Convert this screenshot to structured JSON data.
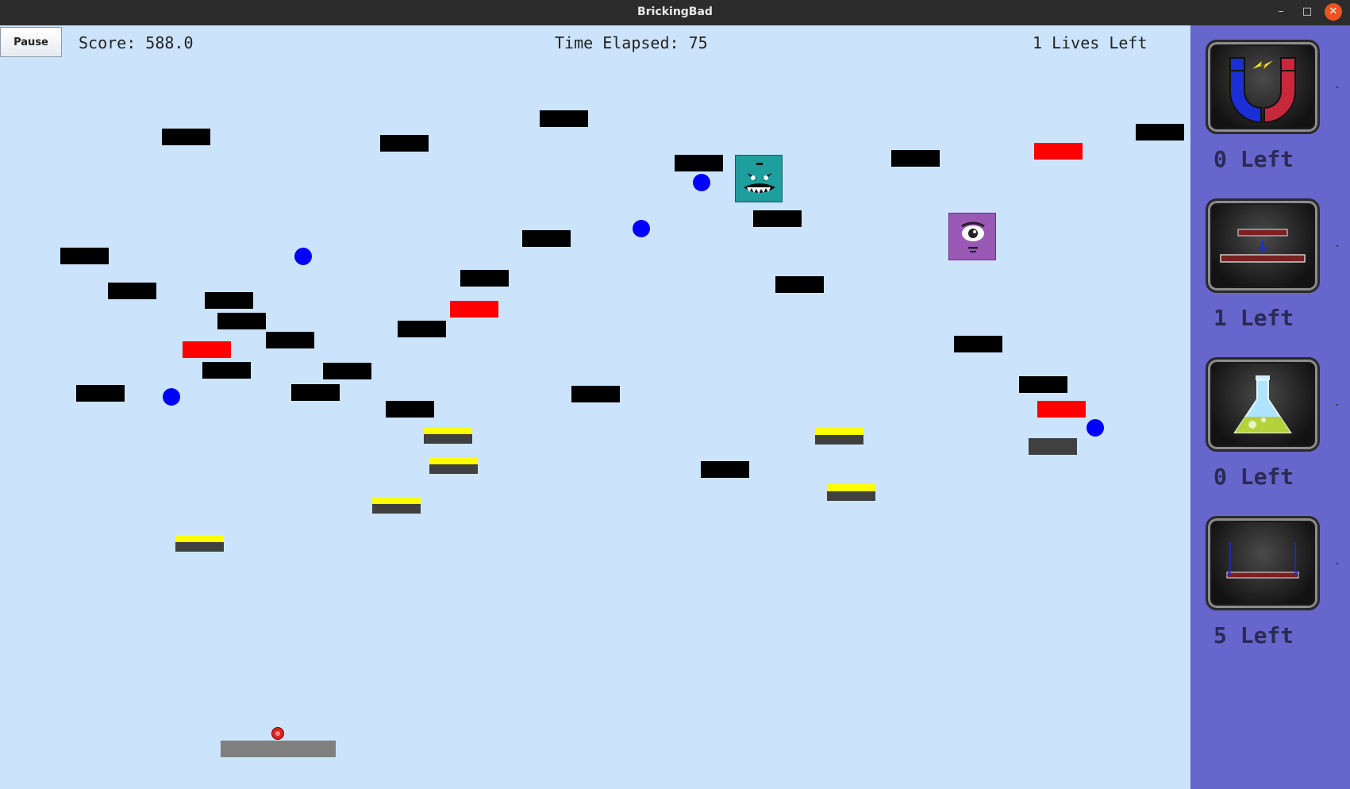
{
  "window": {
    "title": "BrickingBad"
  },
  "hud": {
    "pause_label": "Pause",
    "score_text": "Score: 588.0",
    "time_text": "Time Elapsed: 75",
    "lives_text": "1 Lives Left"
  },
  "abilities": [
    {
      "icon": "magnet-icon",
      "count_text": "0 Left"
    },
    {
      "icon": "paddle-expansion-icon",
      "count_text": "1 Left"
    },
    {
      "icon": "chemical-ball-icon",
      "count_text": "0 Left"
    },
    {
      "icon": "paddle-hex-icon",
      "count_text": "5 Left"
    }
  ],
  "colors": {
    "background": "#cce4fb",
    "sidebar": "#6666cc",
    "simple_brick": "#000000",
    "firm_brick": "#ff0000",
    "half_metal_cap": "#ffff00",
    "brick_dark": "#404040",
    "explosive_ball": "#0000ff",
    "paddle": "#808080"
  }
}
